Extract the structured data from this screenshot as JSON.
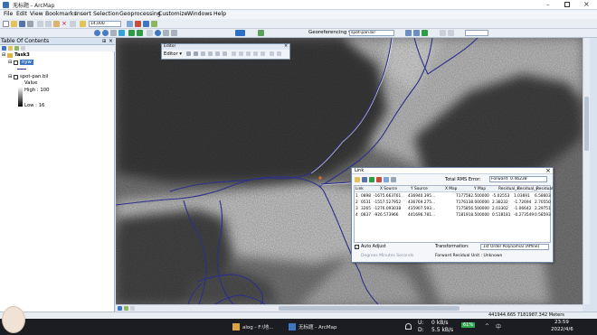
{
  "window": {
    "title": "无标题 - ArcMap"
  },
  "menu": [
    "File",
    "Edit",
    "View",
    "Bookmarks",
    "Insert",
    "Selection",
    "Geoprocessing",
    "Customize",
    "Windows",
    "Help"
  ],
  "toolbar": {
    "scale_value": "14,000",
    "georeferencing_label": "Georeferencing ▾",
    "layer_value": "spot-pan.bil"
  },
  "toc": {
    "header": "Table Of Contents",
    "group_name": "Task3",
    "layer1_name": "nyw",
    "layer2_name": "spot-pan.bil",
    "value_label": "Value",
    "high_label": "High : 100",
    "low_label": "Low : 16"
  },
  "editor": {
    "caption": "Editor",
    "menu_label": "Editor ▾"
  },
  "link_dialog": {
    "caption": "Link",
    "rms_label": "Total RMS Error:",
    "rms_field_value": "Forward: 0.46238",
    "columns": [
      "Link",
      "X Source",
      "Y Source",
      "X Map",
      "Y Map",
      "Residual_x",
      "Residual_y",
      "Residual"
    ],
    "rows": [
      [
        "1",
        "0898",
        "-1675.663761",
        "436940.395...",
        "7177582.500000",
        "-5.02553",
        "1.03691",
        "6.58603"
      ],
      [
        "2",
        "0531",
        "-1557.527952",
        "436769.275...",
        "7176138.000000",
        "2.38232",
        "-1.72694",
        "2.70550"
      ],
      [
        "3",
        "3265",
        "-1276.093038",
        "435907.593...",
        "7175856.500000",
        "2.03302",
        "-1.06642",
        "2.29751"
      ],
      [
        "4",
        "0837",
        "-926.573966",
        "441696.781...",
        "7181918.500000",
        "0.518181",
        "-0.273549",
        "0.58593"
      ]
    ],
    "auto_adjust_label": "Auto Adjust",
    "transformation_label": "Transformation:",
    "transformation_value": "1st Order Polynomial (Affine)",
    "degrees_label": "Degrees Minutes Seconds",
    "forward_residual_label": "Forward Residual Unit : Unknown"
  },
  "status": {
    "coords": "441944.665  7181987.342 Meters"
  },
  "taskbar": {
    "item1": "alog - F:\\地...",
    "item2": "无标题 - ArcMap",
    "net_up": "0 kB/s",
    "net_down": "5.5 kB/s",
    "cpu": "61%",
    "time": "23:59",
    "date": "2022/4/6"
  },
  "colors": {
    "accent": "#3d76c2",
    "rivers": "#2c2f8c",
    "taskbar": "#1c1d22"
  }
}
